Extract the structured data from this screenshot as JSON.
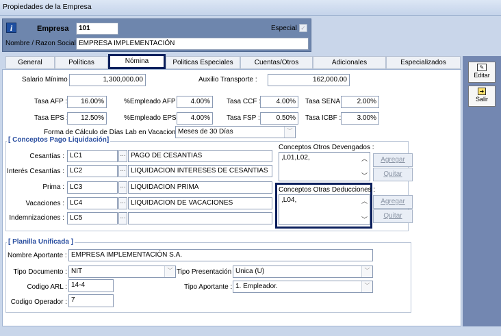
{
  "window": {
    "title": "Propiedades de la Empresa"
  },
  "header": {
    "empresa_label": "Empresa",
    "empresa_value": "101",
    "especial_label": "Especial",
    "especial_checked": "✓",
    "nombre_label": "Nombre / Razon Social",
    "nombre_value": "EMPRESA IMPLEMENTACIÓN"
  },
  "tabs": [
    "General",
    "Políticas",
    "Nómina",
    "Politicas Especiales",
    "Cuentas/Otros",
    "Adicionales",
    "Especializados"
  ],
  "nomina": {
    "salario_label": "Salario Mínimo :",
    "salario_value": "1,300,000.00",
    "auxilio_label": "Auxilio Transporte :",
    "auxilio_value": "162,000.00",
    "tasa_afp_label": "Tasa AFP :",
    "tasa_afp_value": "16.00%",
    "emp_afp_label": "%Empleado AFP :",
    "emp_afp_value": "4.00%",
    "tasa_ccf_label": "Tasa CCF :",
    "tasa_ccf_value": "4.00%",
    "tasa_sena_label": "Tasa SENA :",
    "tasa_sena_value": "2.00%",
    "tasa_eps_label": "Tasa EPS :",
    "tasa_eps_value": "12.50%",
    "emp_eps_label": "%Empleado EPS :",
    "emp_eps_value": "4.00%",
    "tasa_fsp_label": "Tasa FSP :",
    "tasa_fsp_value": "0.50%",
    "tasa_icbf_label": "Tasa ICBF :",
    "tasa_icbf_value": "3.00%",
    "forma_label": "Forma de Cálculo de Días Lab en Vacaciones :",
    "forma_value": "Meses de 30 Días"
  },
  "conceptos": {
    "title": "[ Conceptos Pago Liquidación]",
    "rows": [
      {
        "label": "Cesantías :",
        "code": "LC1",
        "desc": "PAGO DE CESANTIAS"
      },
      {
        "label": "Interés Cesantías :",
        "code": "LC2",
        "desc": "LIQUIDACION INTERESES DE CESANTIAS"
      },
      {
        "label": "Prima :",
        "code": "LC3",
        "desc": "LIQUIDACION PRIMA"
      },
      {
        "label": "Vacaciones :",
        "code": "LC4",
        "desc": "LIQUIDACION DE VACACIONES"
      },
      {
        "label": "Indemnizaciones :",
        "code": "LC5",
        "desc": ""
      }
    ],
    "dots": "...",
    "devengados_label": "Conceptos Otros Devengados :",
    "devengados_value": ",L01,L02,",
    "deducciones_label": "Conceptos Otras Deducciones :",
    "deducciones_value": ",L04,",
    "agregar": "Agregar",
    "quitar": "Quitar"
  },
  "planilla": {
    "title": "[ Planilla Unificada ]",
    "aportante_label": "Nombre Aportante :",
    "aportante_value": "EMPRESA IMPLEMENTACIÓN S.A.",
    "tipo_doc_label": "Tipo Documento :",
    "tipo_doc_value": "NIT",
    "tipo_pres_label": "Tipo Presentación :",
    "tipo_pres_value": "Unica (U)",
    "arl_label": "Codigo ARL :",
    "arl_value": "14-4",
    "tipo_aport_label": "Tipo Aportante :",
    "tipo_aport_value": "1. Empleador.",
    "operador_label": "Codigo Operador :",
    "operador_value": "7"
  },
  "sidebar": {
    "editar": "Editar",
    "salir": "Salir"
  },
  "colors": {
    "accent": "#0b1f5c",
    "group_title": "#2b4fa0",
    "header_bg": "#6e86ad"
  }
}
